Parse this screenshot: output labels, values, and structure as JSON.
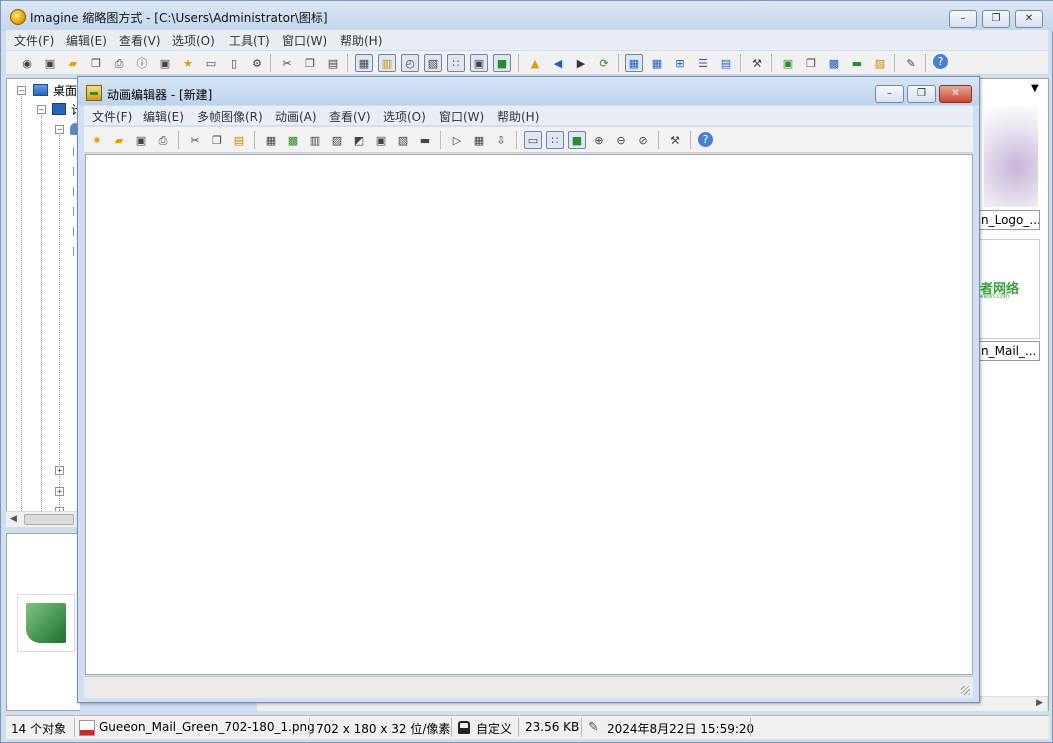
{
  "main_window": {
    "title": "Imagine 缩略图方式 - [C:\\Users\\Administrator\\图标]",
    "menu": [
      "文件(F)",
      "编辑(E)",
      "查看(V)",
      "选项(O)",
      "工具(T)",
      "窗口(W)",
      "帮助(H)"
    ],
    "toolbar_icons": [
      "eye-icon",
      "slideshow-icon",
      "open-folder-icon",
      "copy-files-icon",
      "print-icon",
      "info-icon",
      "camera-icon",
      "folder-star-icon",
      "rename-icon",
      "trash-icon",
      "settings-doc-icon",
      "cut-icon",
      "copy-icon",
      "paste-icon",
      "thumbnail-view-icon",
      "filmstrip-icon",
      "clock-icon",
      "image-view-icon",
      "grid-icon",
      "fit-window-icon",
      "fullscreen-icon",
      "up-folder-icon",
      "back-icon",
      "forward-icon",
      "refresh-icon",
      "large-thumbs-icon",
      "medium-thumbs-icon",
      "small-thumbs-icon",
      "list-icon",
      "details-icon",
      "tools-icon",
      "convert-icon",
      "batch-icon",
      "scan-icon",
      "film-icon",
      "animate-icon",
      "edit-icon",
      "help-icon"
    ]
  },
  "tree": {
    "items": [
      {
        "label": "桌面",
        "icon": "desktop-icon"
      },
      {
        "label": "计",
        "icon": "computer-icon"
      }
    ]
  },
  "right_panel": {
    "thumbnails": [
      {
        "label": "n_Logo_..."
      },
      {
        "label": "n_Mail_...",
        "image_text": "者网络",
        "image_subtext": "eeon.com"
      }
    ]
  },
  "status": {
    "count": "14 个对象",
    "filename": "Gueeon_Mail_Green_702-180_1.png",
    "dimensions": "702 x 180 x 32 位/像素",
    "mode": "自定义",
    "size": "23.56 KB",
    "date": "2024年8月22日 15:59:20"
  },
  "child_window": {
    "title": "动画编辑器 - [新建]",
    "menu": [
      "文件(F)",
      "编辑(E)",
      "多帧图像(R)",
      "动画(A)",
      "查看(V)",
      "选项(O)",
      "窗口(W)",
      "帮助(H)"
    ],
    "toolbar_icons": [
      "new-icon",
      "open-icon",
      "save-icon",
      "print-icon",
      "cut-icon",
      "copy-icon",
      "paste-icon",
      "frame-insert-icon",
      "frame-add-icon",
      "frame-delete-icon",
      "frame-duplicate-icon",
      "frame-invert-icon",
      "frame-crop-icon",
      "frame-split-icon",
      "frame-merge-icon",
      "play-icon",
      "export-icon",
      "import-icon",
      "frame-view-icon",
      "grid-view-icon",
      "image-view-icon",
      "zoom-in-icon",
      "zoom-out-icon",
      "zoom-fit-icon",
      "tools-icon",
      "help-icon"
    ]
  },
  "colors": {
    "frame": "#cfdff0",
    "title_gradient_top": "#dce8f5",
    "canvas": "#ffffff",
    "close_red": "#c9462f"
  }
}
